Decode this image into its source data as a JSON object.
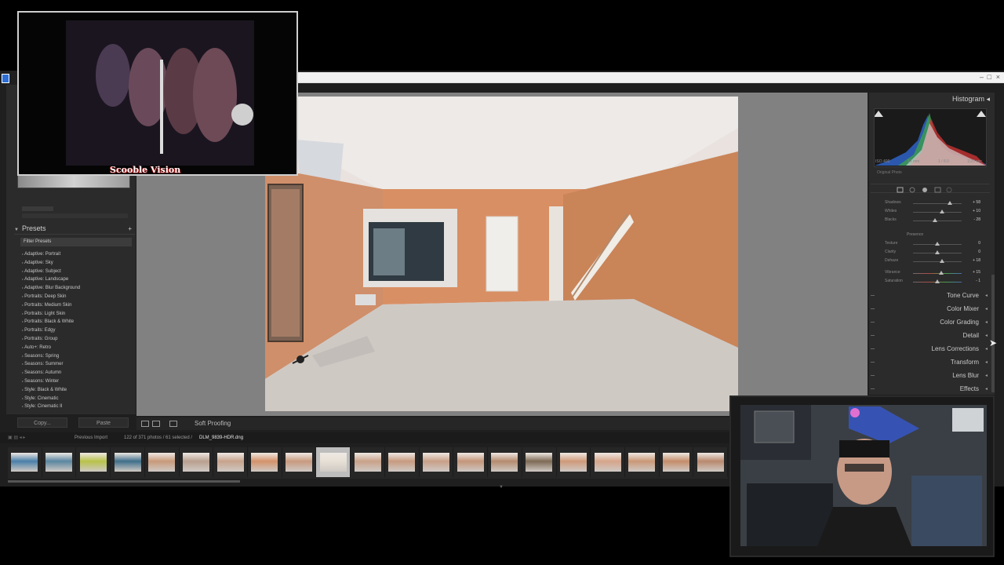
{
  "overlay": {
    "caption": "Scooble Vision"
  },
  "left_panel": {
    "presets_title": "Presets",
    "filter_presets": "Filter Presets",
    "presets": [
      "Adaptive: Portrait",
      "Adaptive: Sky",
      "Adaptive: Subject",
      "Adaptive: Landscape",
      "Adaptive: Blur Background",
      "Portraits: Deep Skin",
      "Portraits: Medium Skin",
      "Portraits: Light Skin",
      "Portraits: Black & White",
      "Portraits: Edgy",
      "Portraits: Group",
      "Auto+: Retro",
      "Seasons: Spring",
      "Seasons: Summer",
      "Seasons: Autumn",
      "Seasons: Winter",
      "Style: Black & White",
      "Style: Cinematic",
      "Style: Cinematic II"
    ],
    "copy_label": "Copy...",
    "paste_label": "Paste"
  },
  "toolbar": {
    "soft_proofing": "Soft Proofing"
  },
  "filmstrip": {
    "source": "Previous Import",
    "count": "122 of 371 photos / 61 selected /",
    "filename": "DLM_9839-HDR.dng",
    "thumb_colors": [
      "#4a7fa8",
      "#5a86a0",
      "#b8c24a",
      "#3f6f8a",
      "#c89a7a",
      "#b9a08e",
      "#c7a38c",
      "#d4926a",
      "#c89a80",
      "#e6e0d6",
      "#c9a289",
      "#c79b80",
      "#c8a087",
      "#c4957a",
      "#b58b6f",
      "#7d6a55",
      "#cf9a7a",
      "#d6a58a",
      "#c99877",
      "#c48d6a",
      "#b9896e"
    ],
    "selected_index": 9
  },
  "right_panel": {
    "histogram_title": "Histogram",
    "histo_meta": [
      "ISO 400",
      "14 mm",
      "1 / 8.0",
      "1/20 sec"
    ],
    "original_photo": "Original Photo",
    "sliders_top": [
      {
        "label": "Shadows",
        "value": "+ 58",
        "pos": 0.75
      },
      {
        "label": "Whites",
        "value": "+ 10",
        "pos": 0.6
      },
      {
        "label": "Blacks",
        "value": "- 28",
        "pos": 0.45
      }
    ],
    "presence_label": "Presence",
    "sliders_presence": [
      {
        "label": "Texture",
        "value": "0",
        "pos": 0.5
      },
      {
        "label": "Clarity",
        "value": "0",
        "pos": 0.5
      },
      {
        "label": "Dehaze",
        "value": "+ 18",
        "pos": 0.6
      },
      {
        "label": "Vibrance",
        "value": "+ 15",
        "pos": 0.58
      },
      {
        "label": "Saturation",
        "value": "- 1",
        "pos": 0.5
      }
    ],
    "sections": [
      "Tone Curve",
      "Color Mixer",
      "Color Grading",
      "Detail",
      "Lens Corrections",
      "Transform",
      "Lens Blur",
      "Effects"
    ]
  }
}
